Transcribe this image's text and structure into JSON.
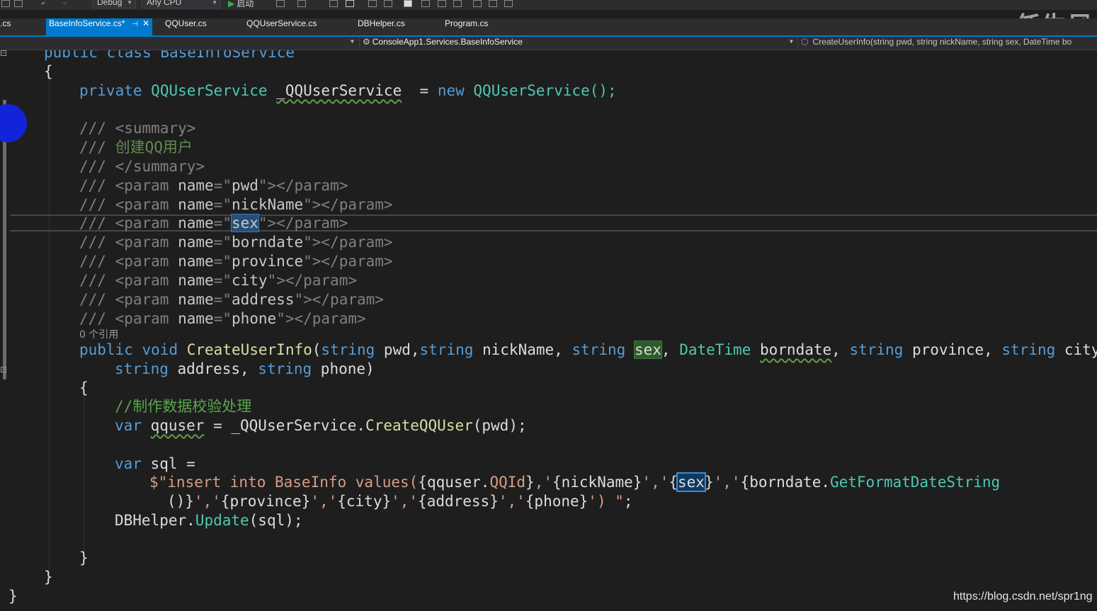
{
  "toolbar": {
    "config_select": "Debug",
    "platform_select": "Any CPU",
    "start_label": "启动"
  },
  "watermark": "任生风",
  "tabs": [
    {
      "label": ".cs"
    },
    {
      "label": "BaseInfoService.cs*",
      "active": true
    },
    {
      "label": "QQUser.cs"
    },
    {
      "label": "QQUserService.cs"
    },
    {
      "label": "DBHelper.cs"
    },
    {
      "label": "Program.cs"
    }
  ],
  "navbar": {
    "class_path": "ConsoleApp1.Services.BaseInfoService",
    "member": "CreateUserInfo(string pwd, string nickName, string sex, DateTime bo"
  },
  "code": {
    "line_class": "public class BaseInfoService",
    "brace_open": "{",
    "field": {
      "kw": "private",
      "type": "QQUserService",
      "name": "_QQUserService",
      "eq": " = ",
      "new_kw": "new",
      "ctor": "QQUserService();"
    },
    "doc_prefix": "/// ",
    "doc_summary_open": "<summary>",
    "doc_summary_text": "创建QQ用户",
    "doc_summary_close": "</summary>",
    "doc_params": [
      "pwd",
      "nickName",
      "sex",
      "borndate",
      "province",
      "city",
      "address",
      "phone"
    ],
    "ref_count": "0 个引用",
    "method_sig_1": "public void CreateUserInfo(string pwd,string nickName, string sex, DateTime borndate, string province, string city,",
    "method_sig_2": "string address, string phone)",
    "method_open": "{",
    "comment": "//制作数据校验处理",
    "var_qquser": "var qquser = _QQUserService.CreateQQUser(pwd);",
    "var_sql": "var sql =",
    "sql_str_1": "$\"insert into BaseInfo values({qquser.QQId},'{nickName}','{sex}','{borndate.GetFormatDateString",
    "sql_str_2": "()}','{province}','{city}','{address}','{phone}') \";",
    "update": "DBHelper.Update(sql);",
    "method_close": "}",
    "class_close": "}",
    "ns_close": "}"
  },
  "credit": "https://blog.csdn.net/spr1ng"
}
